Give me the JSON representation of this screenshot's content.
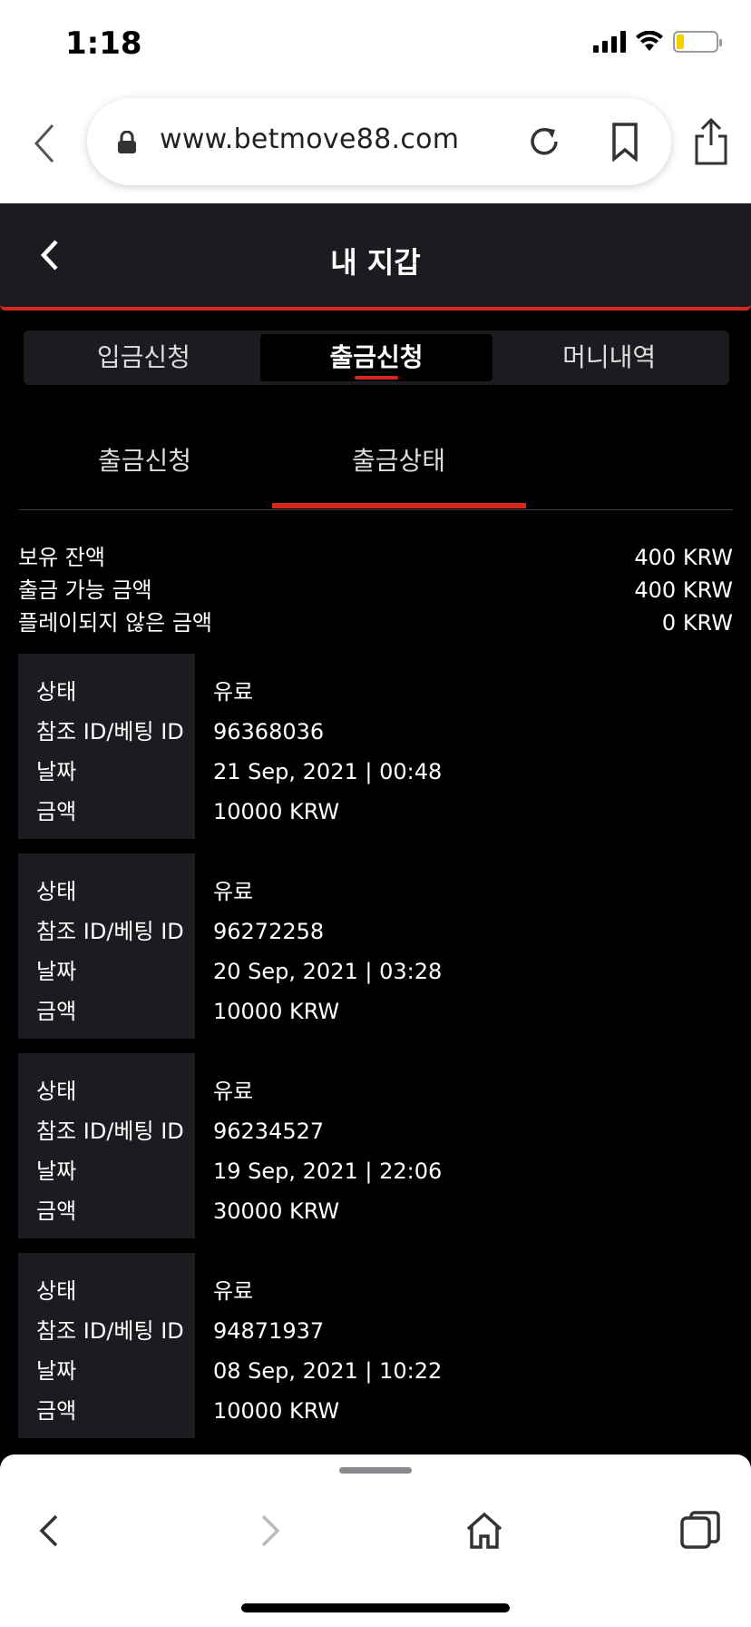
{
  "status_bar": {
    "time": "1:18",
    "icons": [
      "cellular-signal-icon",
      "wifi-icon",
      "battery-icon"
    ],
    "battery_color": "#f5d000"
  },
  "browser": {
    "url": "www.betmove88.com",
    "icons": [
      "back-arrow-icon",
      "lock-icon",
      "reload-icon",
      "bookmark-icon",
      "share-icon"
    ]
  },
  "app_header": {
    "title": "내 지갑",
    "accent": "#d7261d"
  },
  "top_tabs": [
    {
      "label": "입금신청",
      "active": false
    },
    {
      "label": "출금신청",
      "active": true
    },
    {
      "label": "머니내역",
      "active": false
    }
  ],
  "sub_tabs": [
    {
      "label": "출금신청",
      "active": false
    },
    {
      "label": "출금상태",
      "active": true
    }
  ],
  "balances": [
    {
      "label": "보유 잔액",
      "value": "400 KRW"
    },
    {
      "label": "출금 가능 금액",
      "value": "400 KRW"
    },
    {
      "label": "플레이되지 않은 금액",
      "value": "0 KRW"
    }
  ],
  "record_labels": {
    "status": "상태",
    "ref_id": "참조 ID/베팅 ID",
    "date": "날짜",
    "amount": "금액"
  },
  "records": [
    {
      "status": "유료",
      "ref_id": "96368036",
      "date": "21 Sep, 2021 | 00:48",
      "amount": "10000 KRW"
    },
    {
      "status": "유료",
      "ref_id": "96272258",
      "date": "20 Sep, 2021 | 03:28",
      "amount": "10000 KRW"
    },
    {
      "status": "유료",
      "ref_id": "96234527",
      "date": "19 Sep, 2021 | 22:06",
      "amount": "30000 KRW"
    },
    {
      "status": "유료",
      "ref_id": "94871937",
      "date": "08 Sep, 2021 | 10:22",
      "amount": "10000 KRW"
    }
  ],
  "bottom_toolbar": {
    "icons": [
      "back-icon",
      "forward-icon",
      "home-icon",
      "tabs-icon"
    ]
  }
}
